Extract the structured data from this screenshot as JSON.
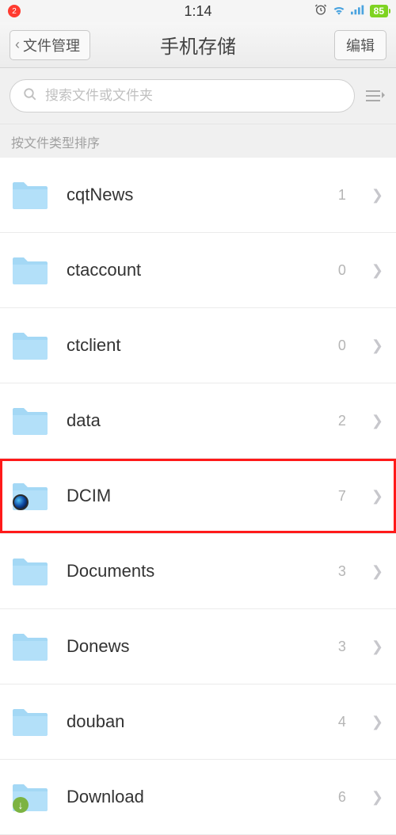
{
  "status": {
    "notif_count": "2",
    "time": "1:14",
    "battery": "85"
  },
  "nav": {
    "back_label": "文件管理",
    "title": "手机存储",
    "edit_label": "编辑"
  },
  "search": {
    "placeholder": "搜索文件或文件夹"
  },
  "sort_label": "按文件类型排序",
  "items": [
    {
      "name": "cqtNews",
      "count": "1",
      "overlay": null,
      "highlighted": false
    },
    {
      "name": "ctaccount",
      "count": "0",
      "overlay": null,
      "highlighted": false
    },
    {
      "name": "ctclient",
      "count": "0",
      "overlay": null,
      "highlighted": false
    },
    {
      "name": "data",
      "count": "2",
      "overlay": null,
      "highlighted": false
    },
    {
      "name": "DCIM",
      "count": "7",
      "overlay": "camera",
      "highlighted": true
    },
    {
      "name": "Documents",
      "count": "3",
      "overlay": null,
      "highlighted": false
    },
    {
      "name": "Donews",
      "count": "3",
      "overlay": null,
      "highlighted": false
    },
    {
      "name": "douban",
      "count": "4",
      "overlay": null,
      "highlighted": false
    },
    {
      "name": "Download",
      "count": "6",
      "overlay": "download",
      "highlighted": false
    }
  ]
}
